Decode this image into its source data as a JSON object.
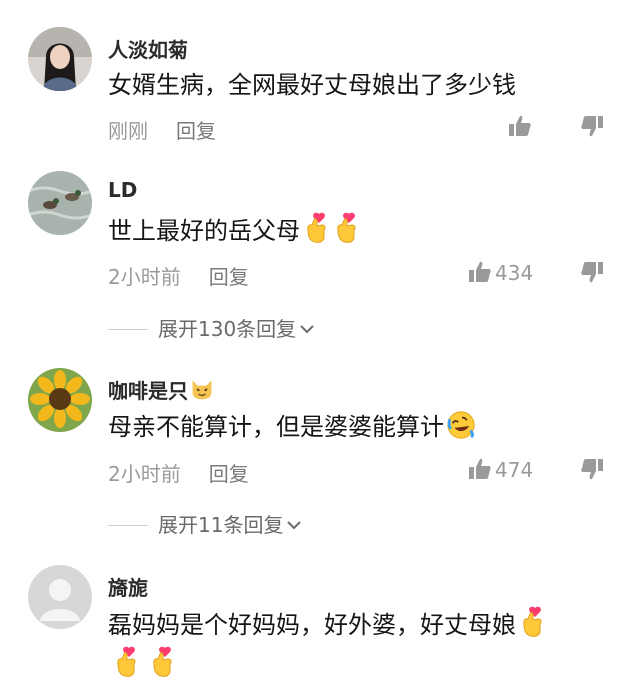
{
  "comments": [
    {
      "username": "人淡如菊",
      "text": "女婿生病，全网最好丈母娘出了多少钱",
      "time": "刚刚",
      "reply_label": "回复",
      "likes": "",
      "avatar_icon": "portrait-woman-avatar"
    },
    {
      "username": "LD",
      "text": "世上最好的岳父母",
      "emojis": [
        "finger-heart-emoji",
        "finger-heart-emoji"
      ],
      "time": "2小时前",
      "reply_label": "回复",
      "likes": "434",
      "expand_label": "展开130条回复",
      "avatar_icon": "ducks-on-water-avatar"
    },
    {
      "username": "咖啡是只",
      "username_emoji": "cat-face-emoji",
      "text": "母亲不能算计，但是婆婆能算计",
      "emojis": [
        "rolling-laughing-emoji"
      ],
      "time": "2小时前",
      "reply_label": "回复",
      "likes": "474",
      "expand_label": "展开11条回复",
      "avatar_icon": "sunflower-avatar"
    },
    {
      "username": "旖旎",
      "text_line1": "磊妈妈是个好妈妈，好外婆，好丈母娘",
      "emojis": [
        "finger-heart-emoji",
        "finger-heart-emoji",
        "finger-heart-emoji"
      ],
      "avatar_icon": "default-user-avatar"
    }
  ],
  "colors": {
    "text": "#151515",
    "meta": "#9a9a9a",
    "username": "#2b2b2b",
    "bg": "#ffffff"
  }
}
